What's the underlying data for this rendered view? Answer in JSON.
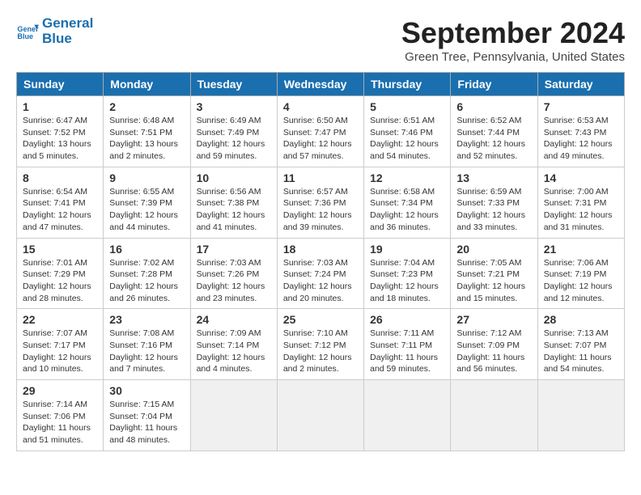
{
  "logo": {
    "line1": "General",
    "line2": "Blue"
  },
  "title": "September 2024",
  "location": "Green Tree, Pennsylvania, United States",
  "days_of_week": [
    "Sunday",
    "Monday",
    "Tuesday",
    "Wednesday",
    "Thursday",
    "Friday",
    "Saturday"
  ],
  "weeks": [
    [
      {
        "num": "1",
        "sunrise": "6:47 AM",
        "sunset": "7:52 PM",
        "daylight": "13 hours and 5 minutes."
      },
      {
        "num": "2",
        "sunrise": "6:48 AM",
        "sunset": "7:51 PM",
        "daylight": "13 hours and 2 minutes."
      },
      {
        "num": "3",
        "sunrise": "6:49 AM",
        "sunset": "7:49 PM",
        "daylight": "12 hours and 59 minutes."
      },
      {
        "num": "4",
        "sunrise": "6:50 AM",
        "sunset": "7:47 PM",
        "daylight": "12 hours and 57 minutes."
      },
      {
        "num": "5",
        "sunrise": "6:51 AM",
        "sunset": "7:46 PM",
        "daylight": "12 hours and 54 minutes."
      },
      {
        "num": "6",
        "sunrise": "6:52 AM",
        "sunset": "7:44 PM",
        "daylight": "12 hours and 52 minutes."
      },
      {
        "num": "7",
        "sunrise": "6:53 AM",
        "sunset": "7:43 PM",
        "daylight": "12 hours and 49 minutes."
      }
    ],
    [
      {
        "num": "8",
        "sunrise": "6:54 AM",
        "sunset": "7:41 PM",
        "daylight": "12 hours and 47 minutes."
      },
      {
        "num": "9",
        "sunrise": "6:55 AM",
        "sunset": "7:39 PM",
        "daylight": "12 hours and 44 minutes."
      },
      {
        "num": "10",
        "sunrise": "6:56 AM",
        "sunset": "7:38 PM",
        "daylight": "12 hours and 41 minutes."
      },
      {
        "num": "11",
        "sunrise": "6:57 AM",
        "sunset": "7:36 PM",
        "daylight": "12 hours and 39 minutes."
      },
      {
        "num": "12",
        "sunrise": "6:58 AM",
        "sunset": "7:34 PM",
        "daylight": "12 hours and 36 minutes."
      },
      {
        "num": "13",
        "sunrise": "6:59 AM",
        "sunset": "7:33 PM",
        "daylight": "12 hours and 33 minutes."
      },
      {
        "num": "14",
        "sunrise": "7:00 AM",
        "sunset": "7:31 PM",
        "daylight": "12 hours and 31 minutes."
      }
    ],
    [
      {
        "num": "15",
        "sunrise": "7:01 AM",
        "sunset": "7:29 PM",
        "daylight": "12 hours and 28 minutes."
      },
      {
        "num": "16",
        "sunrise": "7:02 AM",
        "sunset": "7:28 PM",
        "daylight": "12 hours and 26 minutes."
      },
      {
        "num": "17",
        "sunrise": "7:03 AM",
        "sunset": "7:26 PM",
        "daylight": "12 hours and 23 minutes."
      },
      {
        "num": "18",
        "sunrise": "7:03 AM",
        "sunset": "7:24 PM",
        "daylight": "12 hours and 20 minutes."
      },
      {
        "num": "19",
        "sunrise": "7:04 AM",
        "sunset": "7:23 PM",
        "daylight": "12 hours and 18 minutes."
      },
      {
        "num": "20",
        "sunrise": "7:05 AM",
        "sunset": "7:21 PM",
        "daylight": "12 hours and 15 minutes."
      },
      {
        "num": "21",
        "sunrise": "7:06 AM",
        "sunset": "7:19 PM",
        "daylight": "12 hours and 12 minutes."
      }
    ],
    [
      {
        "num": "22",
        "sunrise": "7:07 AM",
        "sunset": "7:17 PM",
        "daylight": "12 hours and 10 minutes."
      },
      {
        "num": "23",
        "sunrise": "7:08 AM",
        "sunset": "7:16 PM",
        "daylight": "12 hours and 7 minutes."
      },
      {
        "num": "24",
        "sunrise": "7:09 AM",
        "sunset": "7:14 PM",
        "daylight": "12 hours and 4 minutes."
      },
      {
        "num": "25",
        "sunrise": "7:10 AM",
        "sunset": "7:12 PM",
        "daylight": "12 hours and 2 minutes."
      },
      {
        "num": "26",
        "sunrise": "7:11 AM",
        "sunset": "7:11 PM",
        "daylight": "11 hours and 59 minutes."
      },
      {
        "num": "27",
        "sunrise": "7:12 AM",
        "sunset": "7:09 PM",
        "daylight": "11 hours and 56 minutes."
      },
      {
        "num": "28",
        "sunrise": "7:13 AM",
        "sunset": "7:07 PM",
        "daylight": "11 hours and 54 minutes."
      }
    ],
    [
      {
        "num": "29",
        "sunrise": "7:14 AM",
        "sunset": "7:06 PM",
        "daylight": "11 hours and 51 minutes."
      },
      {
        "num": "30",
        "sunrise": "7:15 AM",
        "sunset": "7:04 PM",
        "daylight": "11 hours and 48 minutes."
      },
      null,
      null,
      null,
      null,
      null
    ]
  ]
}
